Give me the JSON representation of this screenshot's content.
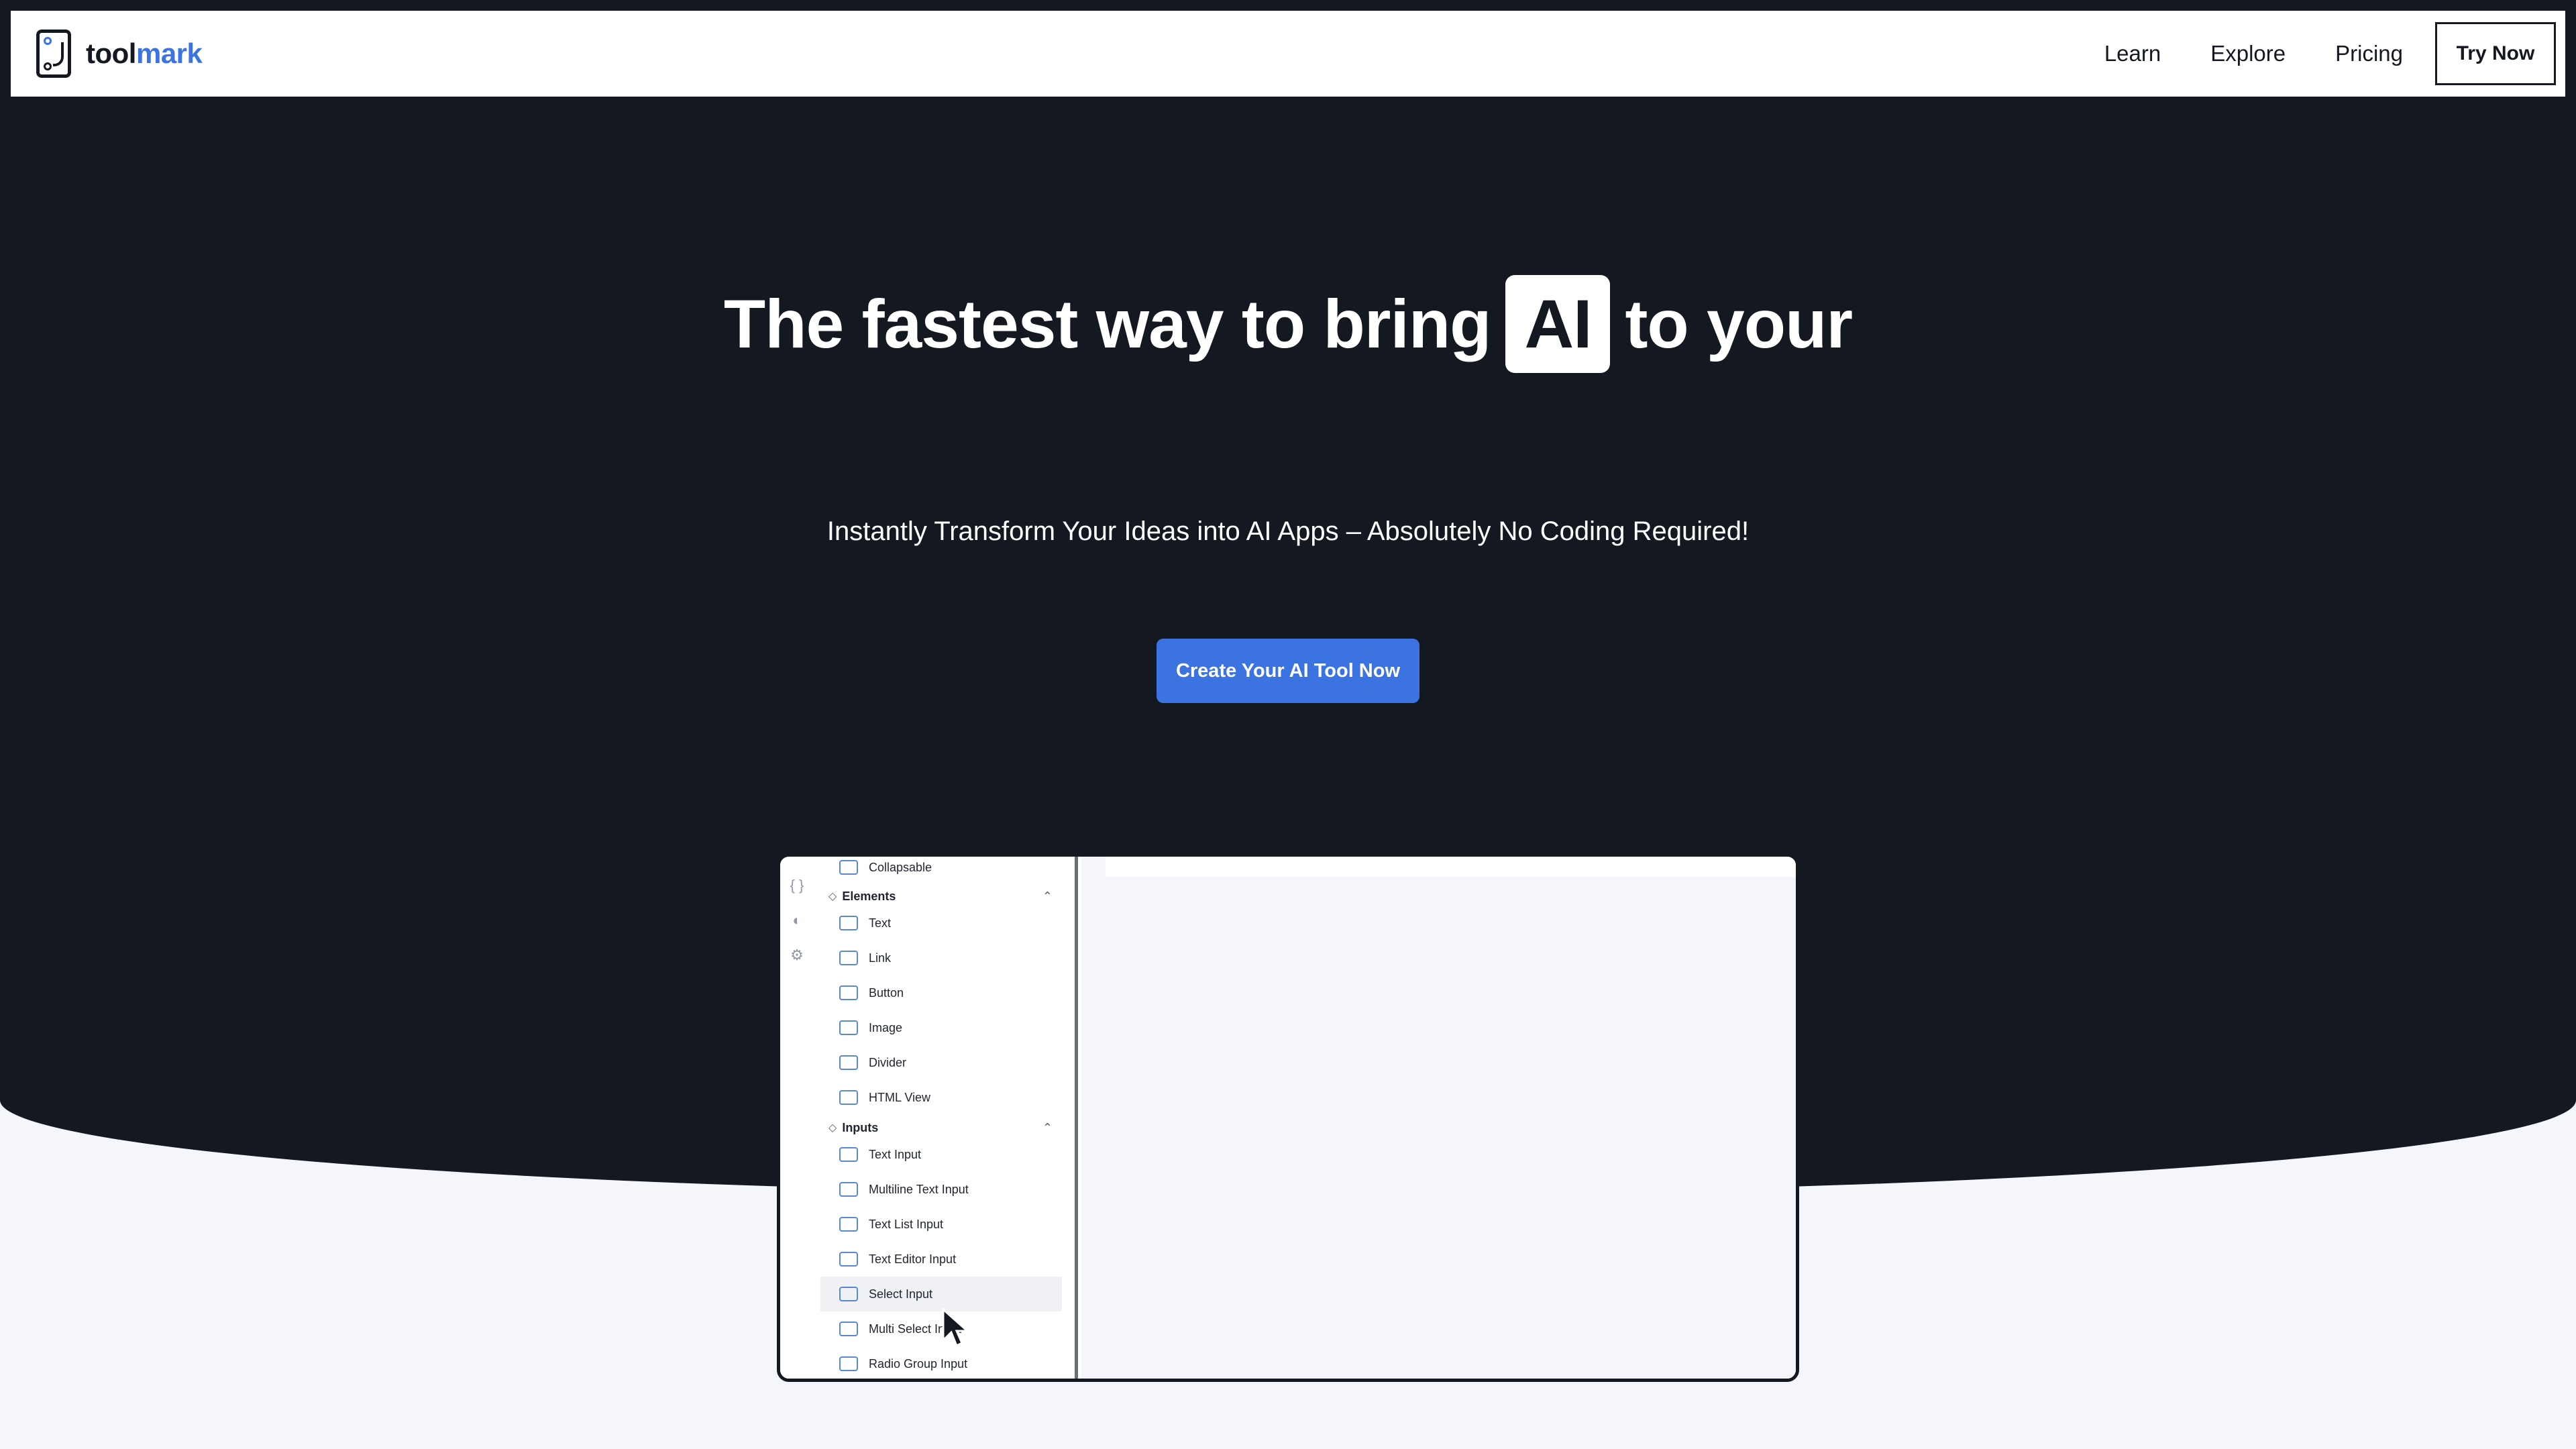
{
  "nav": {
    "logo_prefix": "tool",
    "logo_suffix": "mark",
    "links": [
      "Learn",
      "Explore",
      "Pricing"
    ],
    "cta": "Try Now"
  },
  "hero": {
    "title_before": "The fastest way to bring",
    "title_highlight": "AI",
    "title_after": "to your",
    "subtitle": "Instantly Transform Your Ideas into AI Apps – Absolutely No Coding Required!",
    "cta": "Create Your AI Tool Now"
  },
  "preview": {
    "rail_icons": [
      "code-braces-icon",
      "palette-icon",
      "gear-icon"
    ],
    "rows": [
      {
        "type": "item",
        "label": "Collapsable",
        "icon": "collapsable-icon"
      },
      {
        "type": "head",
        "label": "Elements",
        "icon": "elements-icon"
      },
      {
        "type": "item",
        "label": "Text",
        "icon": "text-icon"
      },
      {
        "type": "item",
        "label": "Link",
        "icon": "link-icon"
      },
      {
        "type": "item",
        "label": "Button",
        "icon": "button-icon"
      },
      {
        "type": "item",
        "label": "Image",
        "icon": "image-icon"
      },
      {
        "type": "item",
        "label": "Divider",
        "icon": "divider-icon"
      },
      {
        "type": "item",
        "label": "HTML View",
        "icon": "code-icon"
      },
      {
        "type": "head",
        "label": "Inputs",
        "icon": "inputs-icon"
      },
      {
        "type": "item",
        "label": "Text Input",
        "icon": "text-input-icon"
      },
      {
        "type": "item",
        "label": "Multiline Text Input",
        "icon": "multiline-input-icon"
      },
      {
        "type": "item",
        "label": "Text List Input",
        "icon": "text-list-icon"
      },
      {
        "type": "item",
        "label": "Text Editor Input",
        "icon": "text-editor-icon"
      },
      {
        "type": "item",
        "label": "Select Input",
        "icon": "select-input-icon",
        "hover": true
      },
      {
        "type": "item",
        "label": "Multi Select Input",
        "icon": "multi-select-icon"
      },
      {
        "type": "item",
        "label": "Radio Group Input",
        "icon": "radio-group-icon"
      }
    ]
  },
  "colors": {
    "dark": "#141821",
    "accent": "#3b73e0",
    "light_bg": "#f5f6fb"
  }
}
